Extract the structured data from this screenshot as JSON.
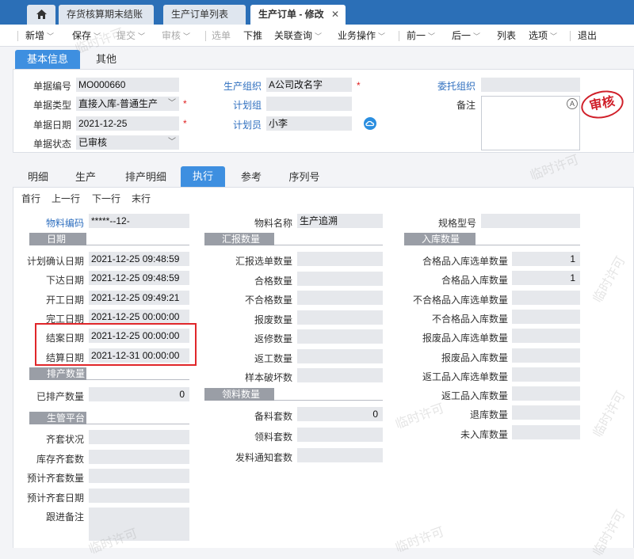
{
  "tabs": [
    {
      "label": "存货核算期末结账"
    },
    {
      "label": "生产订单列表"
    },
    {
      "label": "生产订单 - 修改",
      "close": "✕"
    }
  ],
  "toolbar": {
    "new": "新增",
    "save": "保存",
    "submit": "提交",
    "audit": "审核",
    "select": "选单",
    "push": "下推",
    "linked": "关联查询",
    "ops": "业务操作",
    "prev": "前一",
    "next": "后一",
    "list": "列表",
    "options": "选项",
    "exit": "退出"
  },
  "header_tabs": {
    "basic": "基本信息",
    "other": "其他"
  },
  "header": {
    "bill_no_label": "单据编号",
    "bill_no": "MO000660",
    "bill_type_label": "单据类型",
    "bill_type": "直接入库-普通生产",
    "bill_date_label": "单据日期",
    "bill_date": "2021-12-25",
    "bill_status_label": "单据状态",
    "bill_status": "已审核",
    "prod_org_label": "生产组织",
    "prod_org": "A公司改名字",
    "plan_group_label": "计划组",
    "plan_group": "",
    "planner_label": "计划员",
    "planner": "小李",
    "entrust_org_label": "委托组织",
    "entrust_org": "",
    "remark_label": "备注",
    "remark": "",
    "stamp": "审核"
  },
  "detail_tabs": [
    "明细",
    "生产",
    "排产明细",
    "执行",
    "参考",
    "序列号"
  ],
  "nav": {
    "first": "首行",
    "prev": "上一行",
    "next": "下一行",
    "last": "末行"
  },
  "exec": {
    "material_code_label": "物料编码",
    "material_code": "*****--12-",
    "material_name_label": "物料名称",
    "material_name": "生产追溯",
    "spec_label": "规格型号",
    "spec": "",
    "date_section": "日期",
    "dates": [
      {
        "label": "计划确认日期",
        "value": "2021-12-25 09:48:59"
      },
      {
        "label": "下达日期",
        "value": "2021-12-25 09:48:59"
      },
      {
        "label": "开工日期",
        "value": "2021-12-25 09:49:21"
      },
      {
        "label": "完工日期",
        "value": "2021-12-25 00:00:00"
      },
      {
        "label": "结案日期",
        "value": "2021-12-25 00:00:00"
      },
      {
        "label": "结算日期",
        "value": "2021-12-31 00:00:00"
      }
    ],
    "sched_section": "排产数量",
    "scheduled_label": "已排产数量",
    "scheduled": "0",
    "platform_section": "生管平台",
    "platform": [
      {
        "label": "齐套状况",
        "value": ""
      },
      {
        "label": "库存齐套数",
        "value": ""
      },
      {
        "label": "预计齐套数量",
        "value": ""
      },
      {
        "label": "预计齐套日期",
        "value": ""
      },
      {
        "label": "跟进备注",
        "value": ""
      }
    ],
    "report_section": "汇报数量",
    "report": [
      {
        "label": "汇报选单数量",
        "value": ""
      },
      {
        "label": "合格数量",
        "value": ""
      },
      {
        "label": "不合格数量",
        "value": ""
      },
      {
        "label": "报废数量",
        "value": ""
      },
      {
        "label": "返修数量",
        "value": ""
      },
      {
        "label": "返工数量",
        "value": ""
      },
      {
        "label": "样本破坏数",
        "value": ""
      }
    ],
    "pick_section": "领料数量",
    "pick": [
      {
        "label": "备料套数",
        "value": "0"
      },
      {
        "label": "领料套数",
        "value": ""
      },
      {
        "label": "发料通知套数",
        "value": ""
      }
    ],
    "instock_section": "入库数量",
    "instock": [
      {
        "label": "合格品入库选单数量",
        "value": "1"
      },
      {
        "label": "合格品入库数量",
        "value": "1"
      },
      {
        "label": "不合格品入库选单数量",
        "value": ""
      },
      {
        "label": "不合格品入库数量",
        "value": ""
      },
      {
        "label": "报废品入库选单数量",
        "value": ""
      },
      {
        "label": "报废品入库数量",
        "value": ""
      },
      {
        "label": "返工品入库选单数量",
        "value": ""
      },
      {
        "label": "返工品入库数量",
        "value": ""
      },
      {
        "label": "退库数量",
        "value": ""
      },
      {
        "label": "未入库数量",
        "value": ""
      }
    ]
  },
  "watermark": "临时许可"
}
